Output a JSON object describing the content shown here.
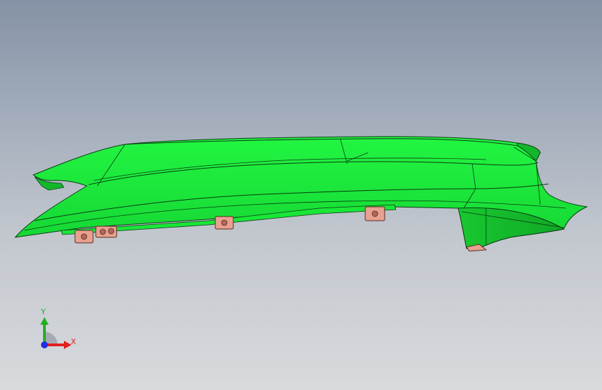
{
  "viewport": {
    "background_top": "#8592a5",
    "background_bottom": "#d8dadd"
  },
  "model": {
    "part_color": "#1ef03c",
    "part_shade_color": "#12b82a",
    "edge_color": "#0a3a12",
    "bracket_color": "#e8a090",
    "bracket_edge_color": "#5a2a20"
  },
  "triad": {
    "x_label": "X",
    "y_label": "Y",
    "x_color": "#e02020",
    "y_color": "#20b020",
    "z_color": "#2030e0",
    "x_icon": "arrow-right-icon",
    "y_icon": "arrow-up-icon"
  }
}
